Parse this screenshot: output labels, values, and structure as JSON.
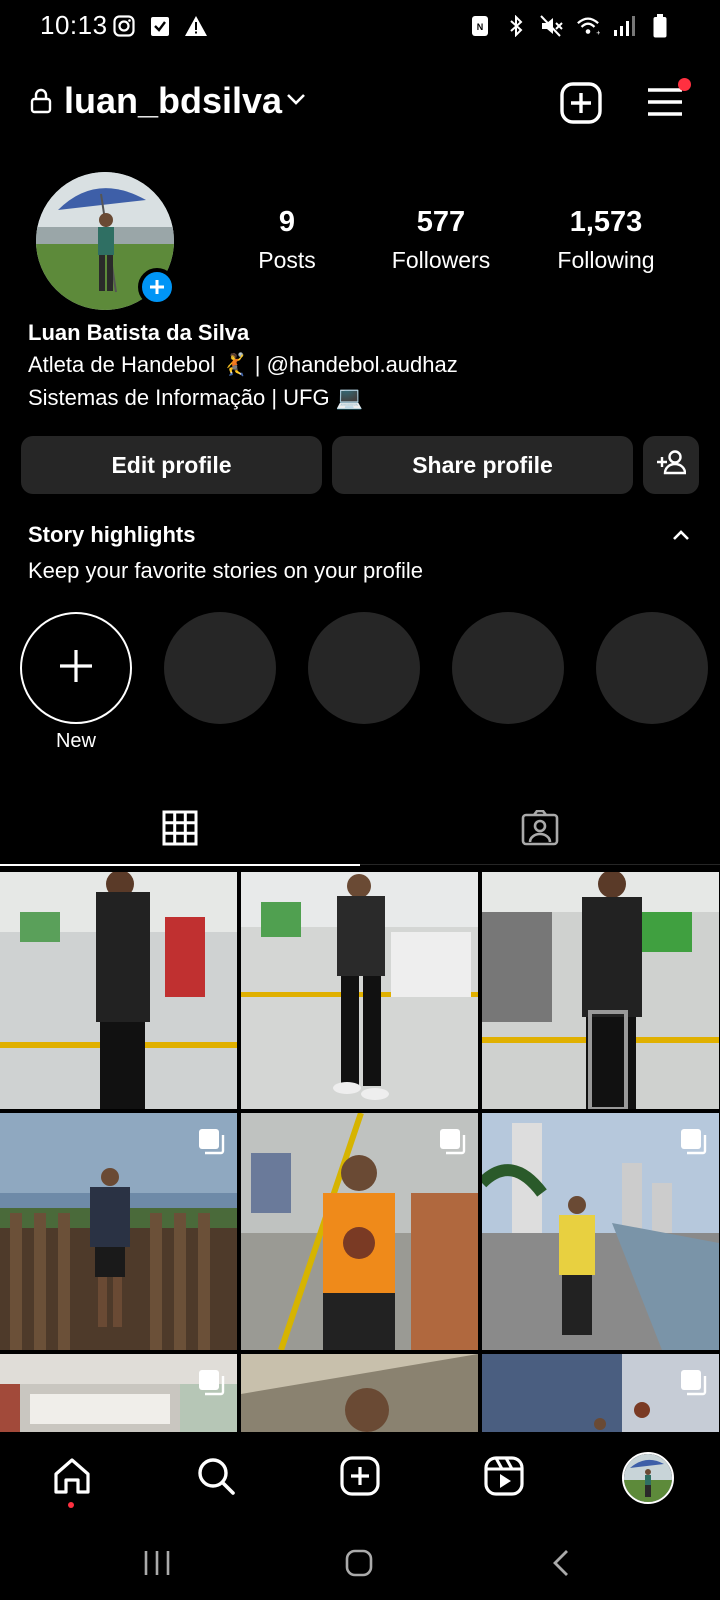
{
  "status_bar": {
    "time": "10:13",
    "left_icons": [
      "instagram-icon",
      "checkbox-icon",
      "warning-icon"
    ],
    "right_icons": [
      "nfc-icon",
      "bluetooth-icon",
      "mute-icon",
      "wifi-icon",
      "signal-icon",
      "battery-icon"
    ]
  },
  "header": {
    "username": "luan_bdsilva",
    "icons": [
      "lock-icon",
      "chevron-down-icon",
      "new-post-icon",
      "menu-icon"
    ],
    "menu_notification": true
  },
  "profile": {
    "stats": [
      {
        "count": "9",
        "label": "Posts"
      },
      {
        "count": "577",
        "label": "Followers"
      },
      {
        "count": "1,573",
        "label": "Following"
      }
    ],
    "name": "Luan Batista da Silva",
    "bio_lines": [
      "Atleta de Handebol 🤾 | @handebol.audhaz",
      "Sistemas de Informação | UFG 💻"
    ]
  },
  "buttons": {
    "edit": "Edit profile",
    "share": "Share profile",
    "discover_icon": "add-person-icon"
  },
  "highlights": {
    "title": "Story highlights",
    "subtitle": "Keep your favorite stories on your profile",
    "new_label": "New"
  },
  "tabs": [
    "grid-icon",
    "tagged-icon"
  ],
  "grid": {
    "multi_image_posts": [
      4,
      5,
      6,
      7,
      9
    ]
  },
  "bottom_nav": [
    "home-icon",
    "search-icon",
    "create-icon",
    "reels-icon",
    "profile-avatar"
  ],
  "colors": {
    "background": "#000000",
    "button": "#262626",
    "accent_blue": "#0095f6",
    "notification_red": "#ff3040"
  }
}
